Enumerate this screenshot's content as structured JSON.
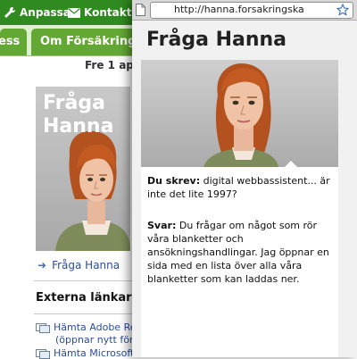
{
  "background_page": {
    "topbar": {
      "customize_label": "Anpassa",
      "contact_label": "Kontakt"
    },
    "nav": {
      "tab_left_label": "ess",
      "tab_about_label": "Om Försäkringsk"
    },
    "date_text": "Fre 1 ap",
    "card": {
      "title_line1": "Fråga",
      "title_line2": "Hanna"
    },
    "hanna_link_label": "Fråga Hanna",
    "external_heading": "Externa länkar",
    "external_links": [
      {
        "label": "Hämta Adobe Re"
      },
      {
        "label": "(öppnar nytt fön"
      },
      {
        "label": "Hämta Microsoft"
      }
    ]
  },
  "popup": {
    "url": "http://hanna.forsakringska",
    "title": "Fråga Hanna",
    "question_label": "Du skrev:",
    "question_text": "digital webbassistent... är inte det lite 1997?",
    "answer_label": "Svar:",
    "answer_text": "Du frågar om något som rör våra blanketter och ansökningshandlingar. Jag öppnar en sida med en lista över alla våra blanketter som kan laddas ner."
  },
  "colors": {
    "topbar_green": "#2f8a1f",
    "tab_green": "#62a833",
    "link_blue": "#2a4e9b"
  },
  "icons": [
    "wrench-icon",
    "envelope-icon",
    "arrow-right-icon",
    "external-link-icon",
    "page-icon",
    "star-icon"
  ]
}
